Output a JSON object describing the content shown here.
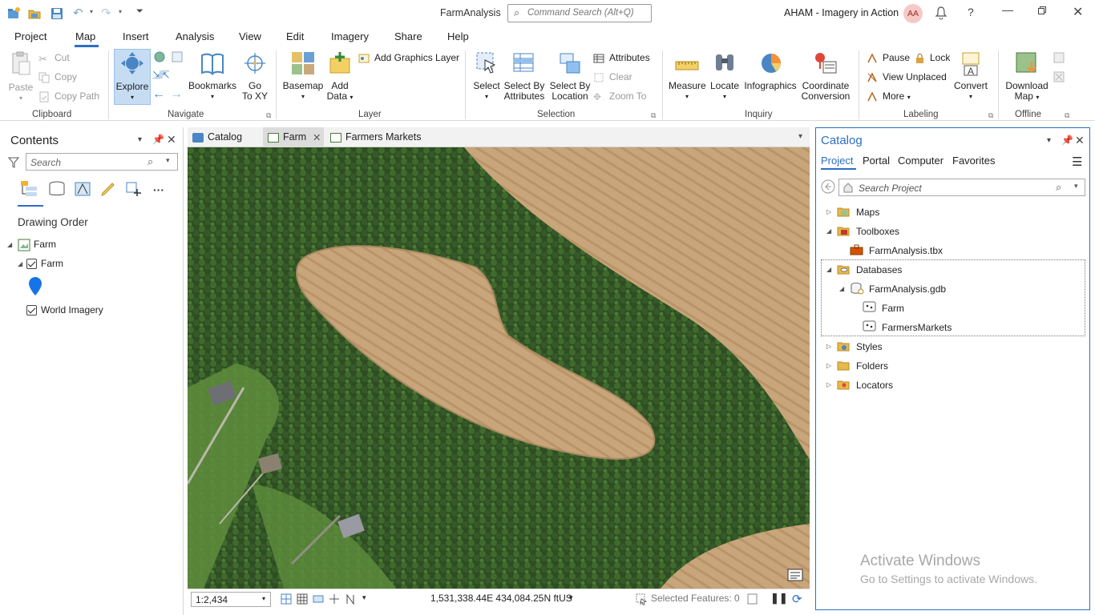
{
  "app": {
    "title": "FarmAnalysis",
    "command_search_placeholder": "Command Search (Alt+Q)",
    "user": "AHAM - Imagery in Action",
    "avatar_initials": "AA"
  },
  "ribbon_tabs": [
    "Project",
    "Map",
    "Insert",
    "Analysis",
    "View",
    "Edit",
    "Imagery",
    "Share",
    "Help"
  ],
  "ribbon": {
    "clipboard": {
      "paste": "Paste",
      "cut": "Cut",
      "copy": "Copy",
      "copy_path": "Copy Path",
      "label": "Clipboard"
    },
    "navigate": {
      "explore": "Explore",
      "bookmarks": "Bookmarks",
      "go_to_xy_1": "Go",
      "go_to_xy_2": "To XY",
      "label": "Navigate"
    },
    "layer": {
      "basemap": "Basemap",
      "add_data_1": "Add",
      "add_data_2": "Data",
      "add_graphics_layer": "Add Graphics Layer",
      "label": "Layer"
    },
    "selection": {
      "select": "Select",
      "select_by_attributes_1": "Select By",
      "select_by_attributes_2": "Attributes",
      "select_by_location_1": "Select By",
      "select_by_location_2": "Location",
      "attributes": "Attributes",
      "clear": "Clear",
      "zoom_to": "Zoom To",
      "label": "Selection"
    },
    "inquiry": {
      "measure": "Measure",
      "locate": "Locate",
      "infographics": "Infographics",
      "coord_1": "Coordinate",
      "coord_2": "Conversion",
      "label": "Inquiry"
    },
    "labeling": {
      "pause": "Pause",
      "lock": "Lock",
      "view_unplaced": "View Unplaced",
      "more": "More",
      "convert": "Convert",
      "label": "Labeling"
    },
    "offline": {
      "download_1": "Download",
      "download_2": "Map",
      "label": "Offline"
    }
  },
  "contents": {
    "title": "Contents",
    "search_placeholder": "Search",
    "drawing_order": "Drawing Order",
    "map_name": "Farm",
    "layers": [
      "Farm",
      "World Imagery"
    ]
  },
  "map_tabs": [
    "Catalog",
    "Farm",
    "Farmers Markets"
  ],
  "status": {
    "scale": "1:2,434",
    "coordinates": "1,531,338.44E 434,084.25N ftUS",
    "selected_features": "Selected Features: 0"
  },
  "catalog": {
    "title": "Catalog",
    "tabs": [
      "Project",
      "Portal",
      "Computer",
      "Favorites"
    ],
    "search_placeholder": "Search Project",
    "items": {
      "maps": "Maps",
      "toolboxes": "Toolboxes",
      "toolbox_file": "FarmAnalysis.tbx",
      "databases": "Databases",
      "gdb": "FarmAnalysis.gdb",
      "fc1": "Farm",
      "fc2": "FarmersMarkets",
      "styles": "Styles",
      "folders": "Folders",
      "locators": "Locators"
    }
  },
  "watermark": {
    "line1": "Activate Windows",
    "line2": "Go to Settings to activate Windows."
  },
  "colors": {
    "accent": "#2b6fc3",
    "explore_active": "#c5dcf3",
    "field": "#c9a97a",
    "forest": "#2e4a23"
  }
}
